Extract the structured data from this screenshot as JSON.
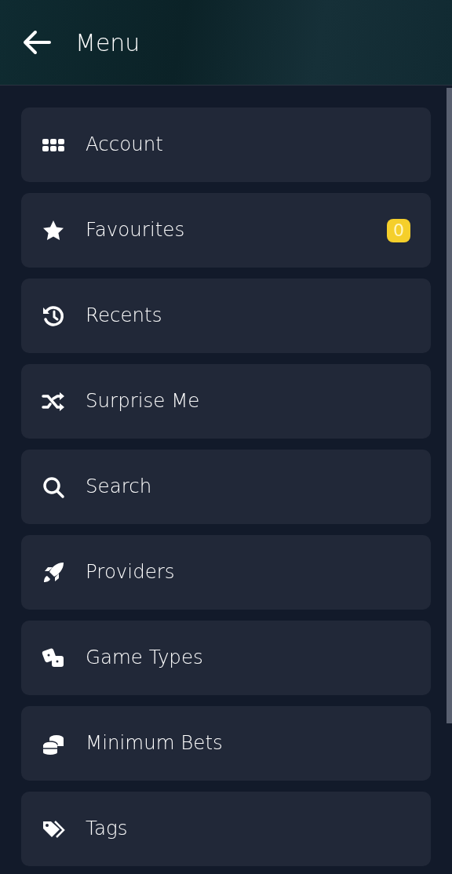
{
  "header": {
    "title": "Menu"
  },
  "items": [
    {
      "label": "Account"
    },
    {
      "label": "Favourites",
      "badge": "0"
    },
    {
      "label": "Recents"
    },
    {
      "label": "Surprise Me"
    },
    {
      "label": "Search"
    },
    {
      "label": "Providers"
    },
    {
      "label": "Game Types"
    },
    {
      "label": "Minimum Bets"
    },
    {
      "label": "Tags"
    }
  ]
}
